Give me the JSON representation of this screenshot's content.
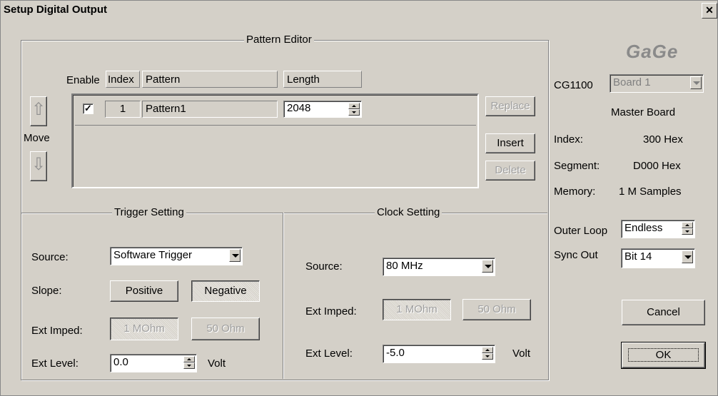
{
  "window": {
    "title": "Setup Digital Output",
    "close_glyph": "✕"
  },
  "pattern_editor": {
    "legend": "Pattern Editor",
    "columns": {
      "enable": "Enable",
      "index": "Index",
      "pattern": "Pattern",
      "length": "Length"
    },
    "rows": [
      {
        "enabled": true,
        "index": "1",
        "pattern": "Pattern1",
        "length": "2048"
      }
    ],
    "move_label": "Move",
    "buttons": {
      "replace": "Replace",
      "insert": "Insert",
      "delete": "Delete"
    }
  },
  "trigger": {
    "legend": "Trigger Setting",
    "source_label": "Source:",
    "source_value": "Software Trigger",
    "slope_label": "Slope:",
    "positive": "Positive",
    "negative": "Negative",
    "imped_label": "Ext Imped:",
    "imped_1m": "1 MOhm",
    "imped_50": "50 Ohm",
    "level_label": "Ext Level:",
    "level_value": "0.0",
    "level_unit": "Volt"
  },
  "clock": {
    "legend": "Clock Setting",
    "source_label": "Source:",
    "source_value": "80 MHz",
    "imped_label": "Ext Imped:",
    "imped_1m": "1 MOhm",
    "imped_50": "50 Ohm",
    "level_label": "Ext Level:",
    "level_value": "-5.0",
    "level_unit": "Volt"
  },
  "side": {
    "logo": "GaGe",
    "board_model": "CG1100",
    "board_select": "Board 1",
    "master": "Master Board",
    "index_label": "Index:",
    "index_value": "300 Hex",
    "segment_label": "Segment:",
    "segment_value": "D000 Hex",
    "memory_label": "Memory:",
    "memory_value": "1 M Samples",
    "outer_loop_label": "Outer Loop",
    "outer_loop_value": "Endless",
    "sync_out_label": "Sync Out",
    "sync_out_value": "Bit 14",
    "cancel": "Cancel",
    "ok": "OK"
  }
}
